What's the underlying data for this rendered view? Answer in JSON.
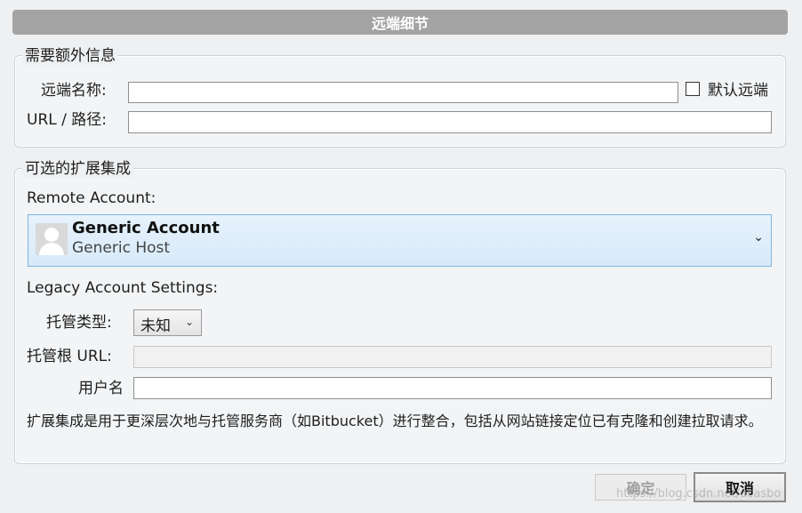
{
  "window": {
    "title": "远端细节"
  },
  "required_group": {
    "title": "需要额外信息",
    "remote_name_label": "远端名称:",
    "remote_name_value": "",
    "default_remote_label": "默认远端",
    "default_remote_checked": false,
    "url_label": "URL / 路径:",
    "url_value": ""
  },
  "optional_group": {
    "title": "可选的扩展集成",
    "remote_account_label": "Remote Account:",
    "account": {
      "name": "Generic Account",
      "host": "Generic Host",
      "icon": "user-avatar-icon"
    },
    "legacy_label": "Legacy Account Settings:",
    "hosting_type_label": "托管类型:",
    "hosting_type_value": "未知",
    "hosting_root_label": "托管根 URL:",
    "hosting_root_value": "",
    "username_label": "用户名",
    "username_value": "",
    "description": "扩展集成是用于更深层次地与托管服务商（如Bitbucket）进行整合，包括从网站链接定位已有克隆和创建拉取请求。"
  },
  "buttons": {
    "ok": "确定",
    "cancel": "取消"
  },
  "watermark": "https://blog.csdn.net/ucasbo"
}
